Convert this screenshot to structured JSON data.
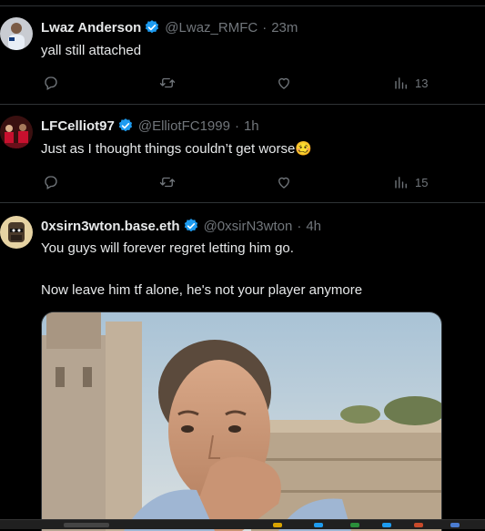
{
  "tweets": [
    {
      "name": "Lwaz Anderson",
      "handle": "@Lwaz_RMFC",
      "sep": "·",
      "time": "23m",
      "text": "yall still attached",
      "views": "13"
    },
    {
      "name": "LFCelliot97",
      "handle": "@ElliotFC1999",
      "sep": "·",
      "time": "1h",
      "text": "Just as I thought things couldn’t get worse🥴",
      "views": "15"
    },
    {
      "name": "0xsirn3wton.base.eth",
      "handle": "@0xsirN3wton",
      "sep": "·",
      "time": "4h",
      "text_line1": "You guys will forever regret letting him go.",
      "text_line2": "Now leave him tf alone, he's not your player anymore"
    }
  ],
  "icons": {
    "reply": "reply-icon",
    "retweet": "retweet-icon",
    "like": "like-icon",
    "views": "views-icon",
    "verified": "verified-badge-icon"
  },
  "colors": {
    "background": "#000000",
    "text": "#e7e9ea",
    "muted": "#71767b",
    "verified": "#1d9bf0",
    "divider": "#2f3336"
  }
}
